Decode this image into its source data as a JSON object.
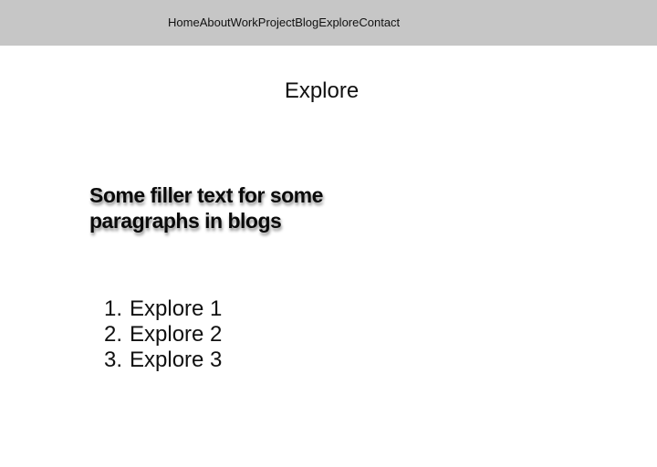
{
  "nav": {
    "items": [
      {
        "label": "Home"
      },
      {
        "label": "About"
      },
      {
        "label": "Work"
      },
      {
        "label": "Project"
      },
      {
        "label": "Blog"
      },
      {
        "label": "Explore"
      },
      {
        "label": "Contact"
      }
    ],
    "background": "#c6c6c6"
  },
  "page": {
    "title": "Explore"
  },
  "blog": {
    "heading": "Some filler text for some paragraphs in blogs"
  },
  "explore_list": {
    "items": [
      {
        "number": "1",
        "label": "Explore 1"
      },
      {
        "number": "2",
        "label": "Explore 2"
      },
      {
        "number": "3",
        "label": "Explore 3"
      }
    ]
  }
}
